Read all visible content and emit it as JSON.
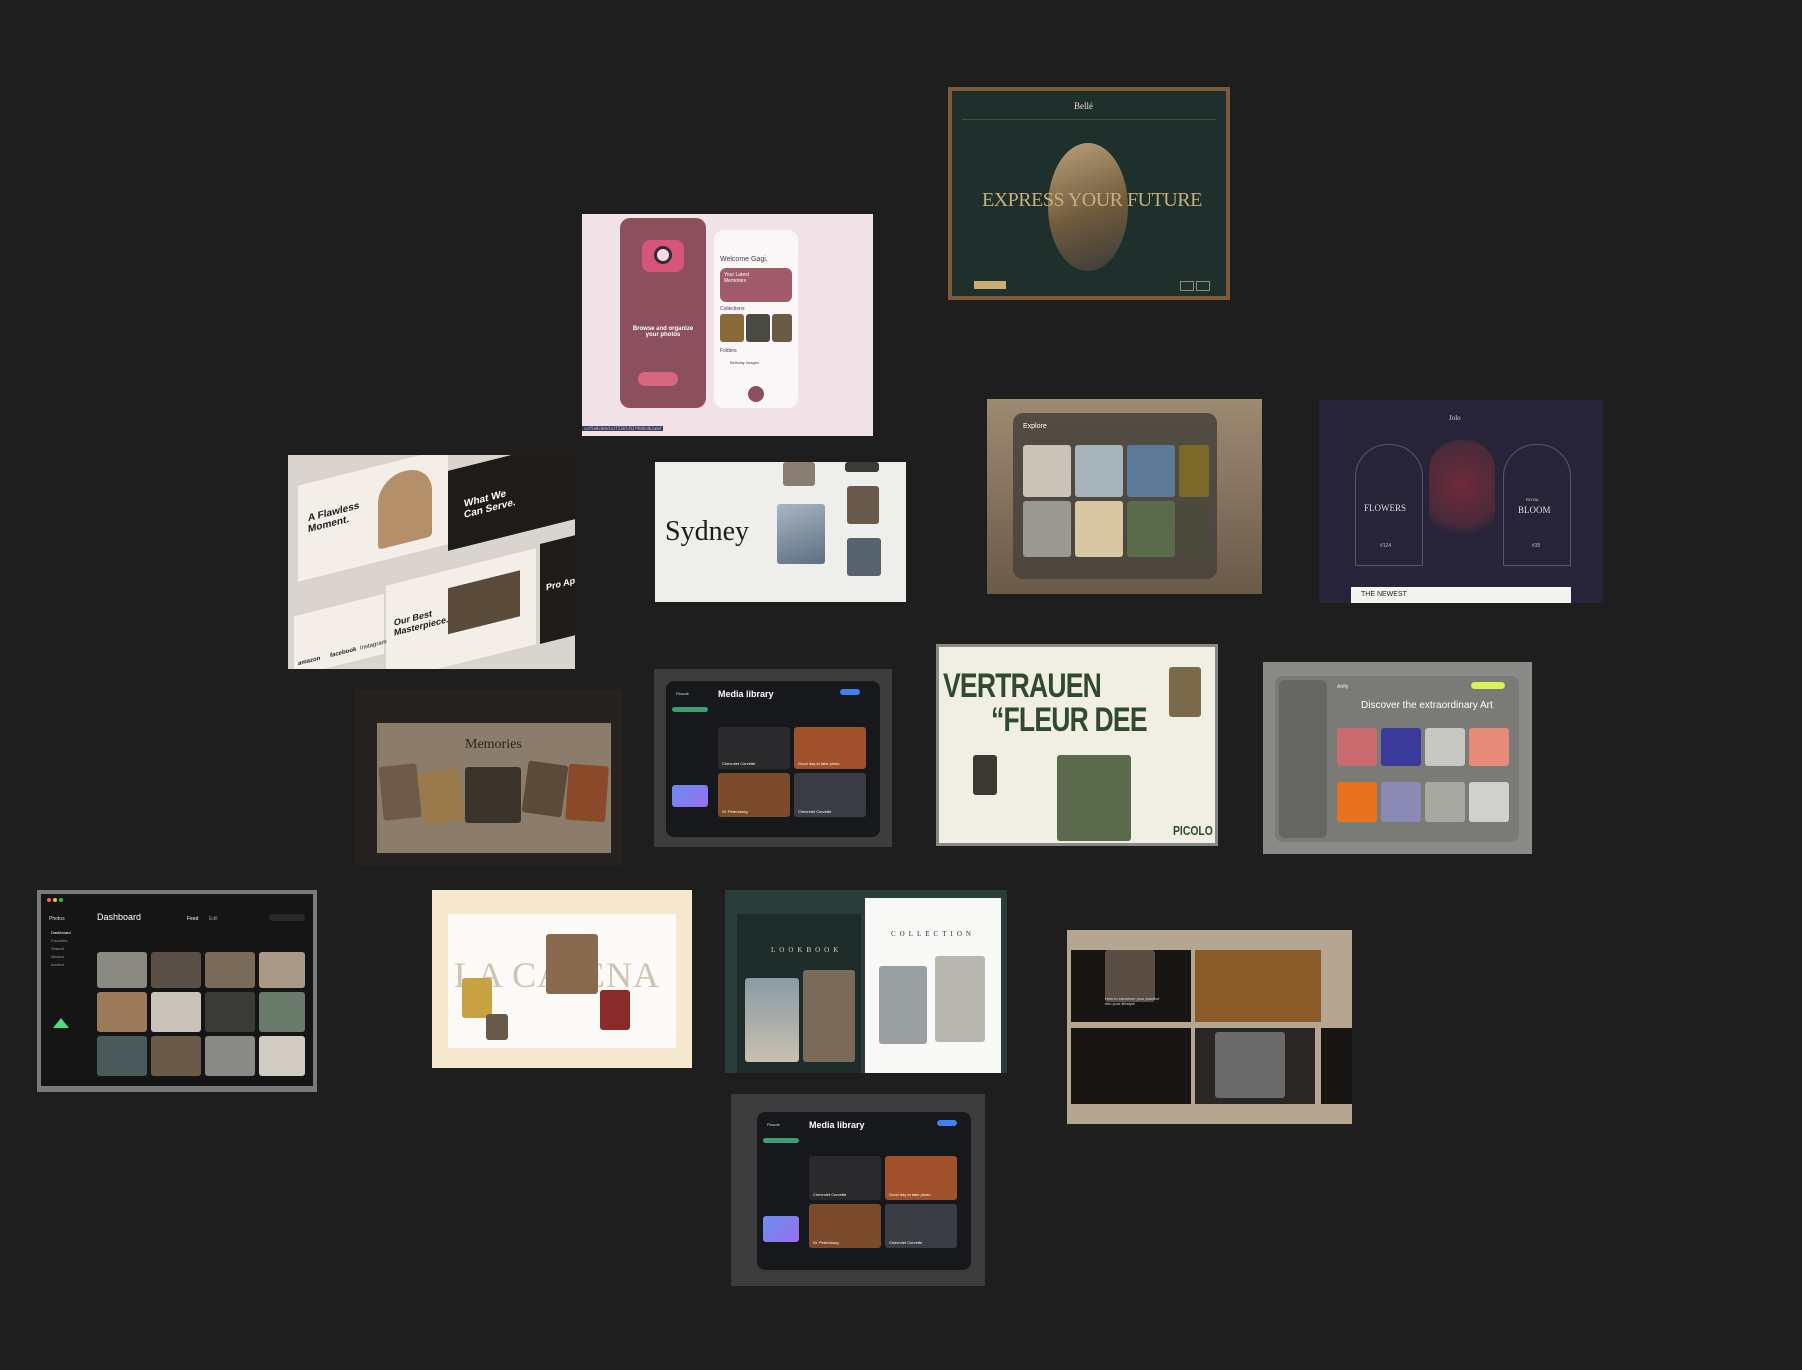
{
  "canvas": {
    "background": "#1e1e1e"
  },
  "colors": {
    "green_dark": "#1f2f2b",
    "bronze": "#a87a4b",
    "navy": "#2b2744",
    "cream": "#efe9dd",
    "accent_blue": "#3b82f6",
    "lime": "#d7f25a"
  },
  "belle": {
    "brand": "Bellé",
    "headline": "EXPRESS YOUR FUTURE"
  },
  "gagi": {
    "welcome": "Welcome Gagi,",
    "browse": "Browse and organize your photos",
    "latest": "Your Latest Memories",
    "collections": "Collections",
    "folders": "Folders",
    "birthday": "Birthday Images",
    "filename": "caf5e0c0de5a1f2387d52f9b6b4b3a8d"
  },
  "flawless": {
    "title": "A Flawless Moment.",
    "serve": "What We Can Serve.",
    "best": "Our Best Masterpiece.",
    "brands": [
      "amazon",
      "facebook",
      "Instagram"
    ],
    "pro": "Pro Ap"
  },
  "sydney": {
    "title": "Sydney"
  },
  "explore": {
    "title": "Explore"
  },
  "flowers": {
    "brand": "Jolo",
    "left": "FLOWERS",
    "right_small": "ROYAL",
    "right": "BLOOM",
    "left_num": "#124",
    "right_num": "#35",
    "newest": "THE NEWEST"
  },
  "memories": {
    "title": "Memories"
  },
  "media1": {
    "title": "Media library",
    "brand": "Picsole",
    "items": [
      "Chevrolet Corvette",
      "Good day to take photo",
      "St. Petersburg",
      "Chevrolet Corvette"
    ]
  },
  "vertrauen": {
    "line1": "VERTRAUEN",
    "line2": "“FLEUR DEE",
    "brand": "PICOLO"
  },
  "art": {
    "brand": "Artify",
    "headline": "Discover the extraordinary Art"
  },
  "dashboard": {
    "brand": "Photos",
    "title": "Dashboard",
    "tabs": [
      "Feed",
      "Edit"
    ],
    "sidebar": [
      "Dashboard",
      "Favorites",
      "Shared",
      "Albums",
      "Archive"
    ]
  },
  "catena": {
    "title": "LA CATENA"
  },
  "lookbook": {
    "left": "LOOKBOOK",
    "right": "COLLECTION"
  },
  "yoga": {
    "headline": "How to transform your practice into your lifestyle"
  },
  "media2": {
    "title": "Media library",
    "brand": "Picsole",
    "items": [
      "Chevrolet Corvette",
      "Good day to take photo",
      "St. Petersburg",
      "Chevrolet Corvette"
    ]
  }
}
